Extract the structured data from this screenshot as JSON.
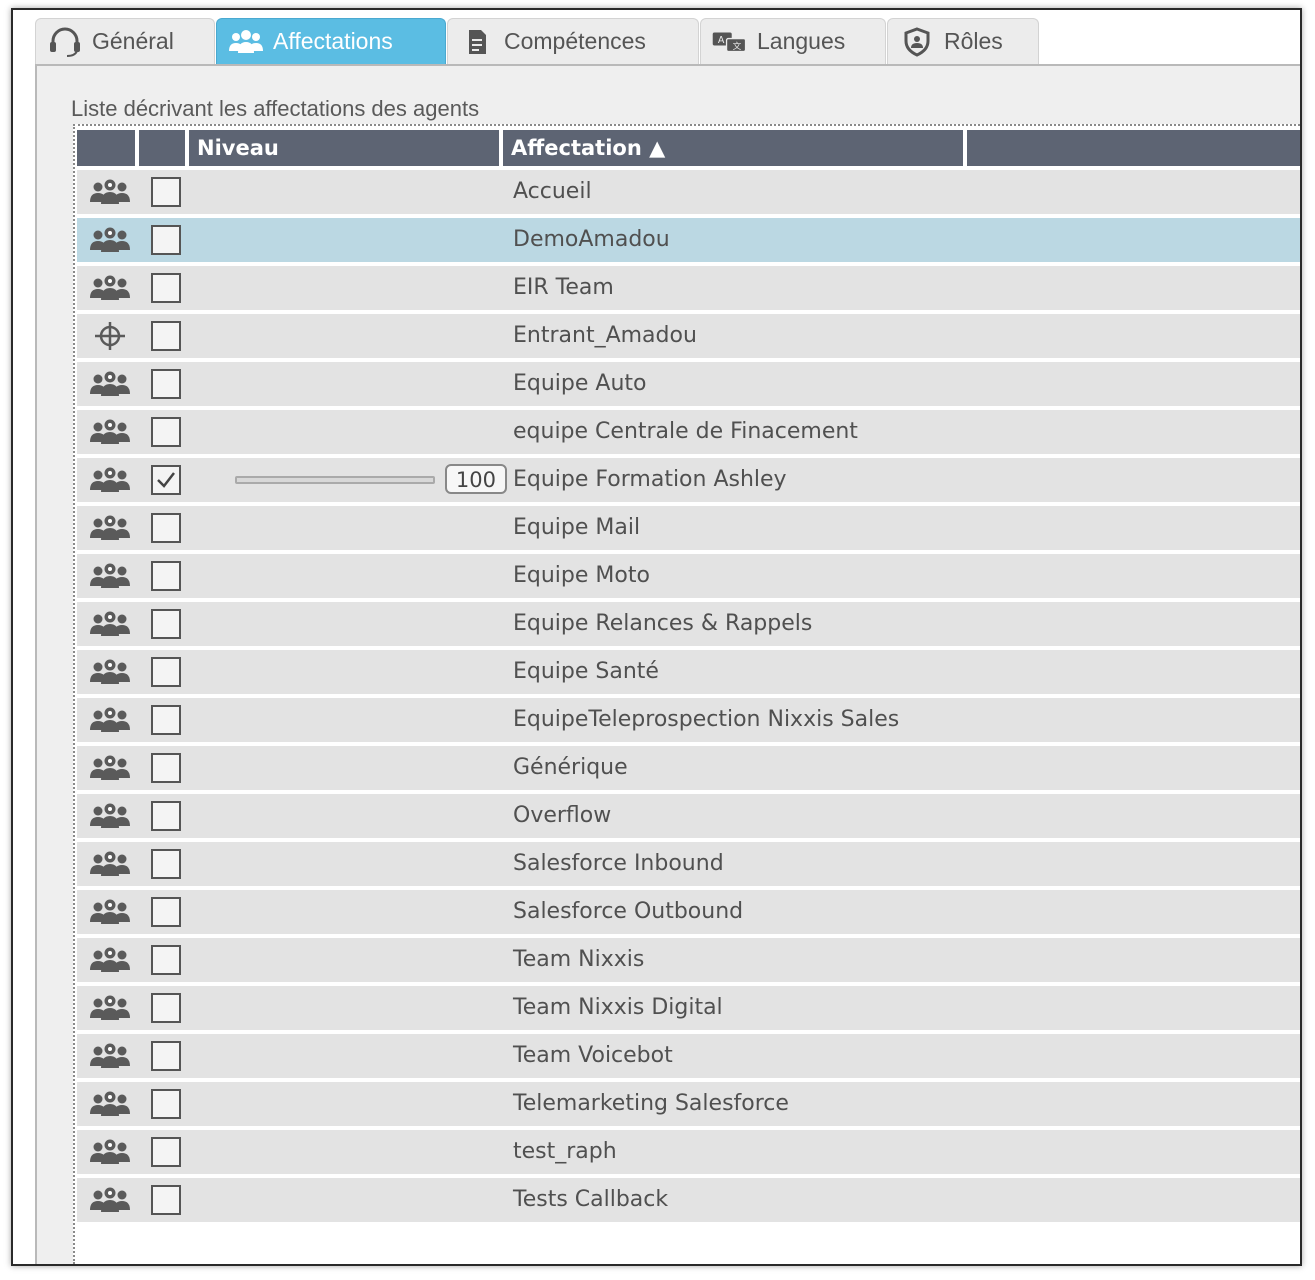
{
  "tabs": [
    {
      "label": "Général",
      "icon": "headset-icon",
      "active": false
    },
    {
      "label": "Affectations",
      "icon": "group-icon",
      "active": true
    },
    {
      "label": "Compétences",
      "icon": "document-icon",
      "active": false
    },
    {
      "label": "Langues",
      "icon": "translate-icon",
      "active": false
    },
    {
      "label": "Rôles",
      "icon": "shield-icon",
      "active": false
    }
  ],
  "caption": "Liste décrivant les affectations des agents",
  "grid": {
    "columns": {
      "level": "Niveau",
      "assignment": "Affectation ▲"
    },
    "rows": [
      {
        "icon": "group-icon",
        "checked": false,
        "name": "Accueil"
      },
      {
        "icon": "group-icon",
        "checked": false,
        "name": "DemoAmadou",
        "selected": true
      },
      {
        "icon": "group-icon",
        "checked": false,
        "name": "EIR Team"
      },
      {
        "icon": "crosshair-icon",
        "checked": false,
        "name": "Entrant_Amadou"
      },
      {
        "icon": "group-icon",
        "checked": false,
        "name": "Equipe Auto"
      },
      {
        "icon": "group-icon",
        "checked": false,
        "name": "equipe Centrale de Finacement"
      },
      {
        "icon": "group-icon",
        "checked": true,
        "name": "Equipe Formation Ashley",
        "level": "100",
        "level_fraction": 1.0
      },
      {
        "icon": "group-icon",
        "checked": false,
        "name": "Equipe Mail"
      },
      {
        "icon": "group-icon",
        "checked": false,
        "name": "Equipe Moto"
      },
      {
        "icon": "group-icon",
        "checked": false,
        "name": "Equipe Relances & Rappels"
      },
      {
        "icon": "group-icon",
        "checked": false,
        "name": "Equipe Santé"
      },
      {
        "icon": "group-icon",
        "checked": false,
        "name": "EquipeTeleprospection Nixxis Sales"
      },
      {
        "icon": "group-icon",
        "checked": false,
        "name": "Générique"
      },
      {
        "icon": "group-icon",
        "checked": false,
        "name": "Overflow"
      },
      {
        "icon": "group-icon",
        "checked": false,
        "name": "Salesforce Inbound"
      },
      {
        "icon": "group-icon",
        "checked": false,
        "name": "Salesforce Outbound"
      },
      {
        "icon": "group-icon",
        "checked": false,
        "name": "Team Nixxis"
      },
      {
        "icon": "group-icon",
        "checked": false,
        "name": "Team Nixxis Digital"
      },
      {
        "icon": "group-icon",
        "checked": false,
        "name": "Team Voicebot"
      },
      {
        "icon": "group-icon",
        "checked": false,
        "name": "Telemarketing Salesforce"
      },
      {
        "icon": "group-icon",
        "checked": false,
        "name": "test_raph"
      },
      {
        "icon": "group-icon",
        "checked": false,
        "name": "Tests Callback"
      }
    ]
  },
  "colors": {
    "active_tab": "#5bbde3",
    "header_bg": "#5d6473",
    "row_bg": "#e3e3e3",
    "row_selected": "#bbd8e3"
  }
}
